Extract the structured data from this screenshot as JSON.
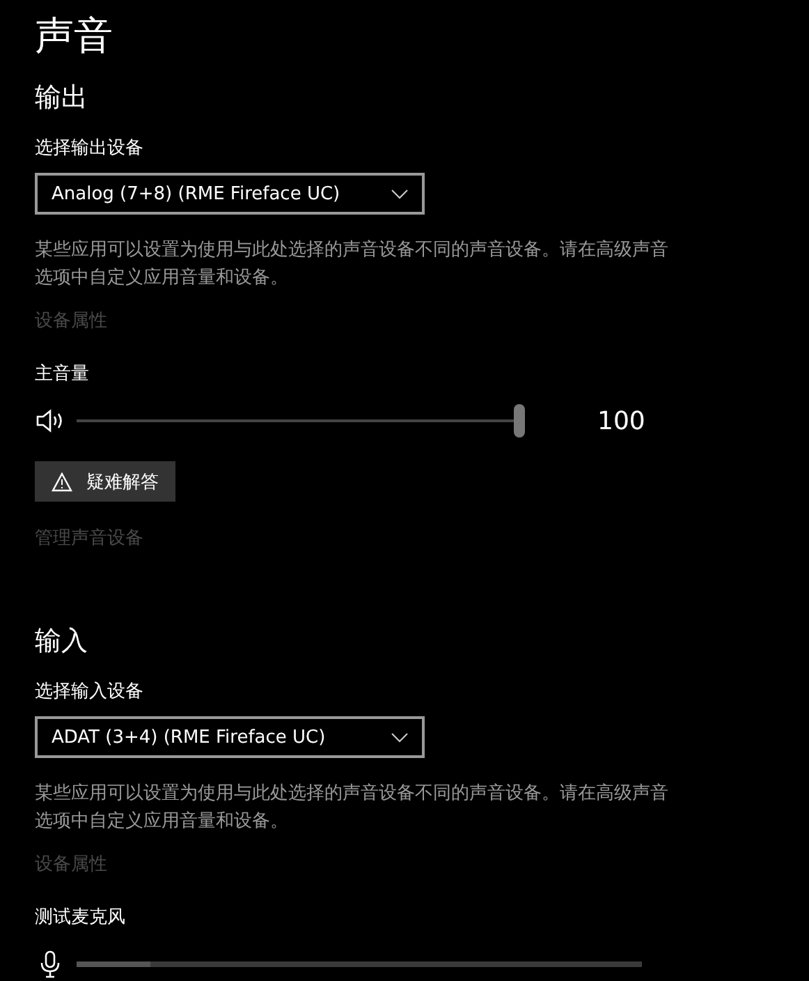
{
  "title": "声音",
  "output": {
    "heading": "输出",
    "device_label": "选择输出设备",
    "device": "Analog (7+8) (RME Fireface UC)",
    "description": "某些应用可以设置为使用与此处选择的声音设备不同的声音设备。请在高级声音选项中自定义应用音量和设备。",
    "properties_link": "设备属性",
    "properties_disabled": true,
    "volume": {
      "label": "主音量",
      "level": 1.0,
      "reading": "100"
    },
    "troubleshoot_button": "疑难解答",
    "manage_link": "管理声音设备",
    "manage_disabled": true
  },
  "input": {
    "heading": "输入",
    "device_label": "选择输入设备",
    "device": "ADAT (3+4) (RME Fireface UC)",
    "description": "某些应用可以设置为使用与此处选择的声音设备不同的声音设备。请在高级声音选项中自定义应用音量和设备。",
    "properties_link": "设备属性",
    "properties_disabled": true,
    "mic_test": {
      "label": "测试麦克风",
      "level": 0.13
    }
  }
}
